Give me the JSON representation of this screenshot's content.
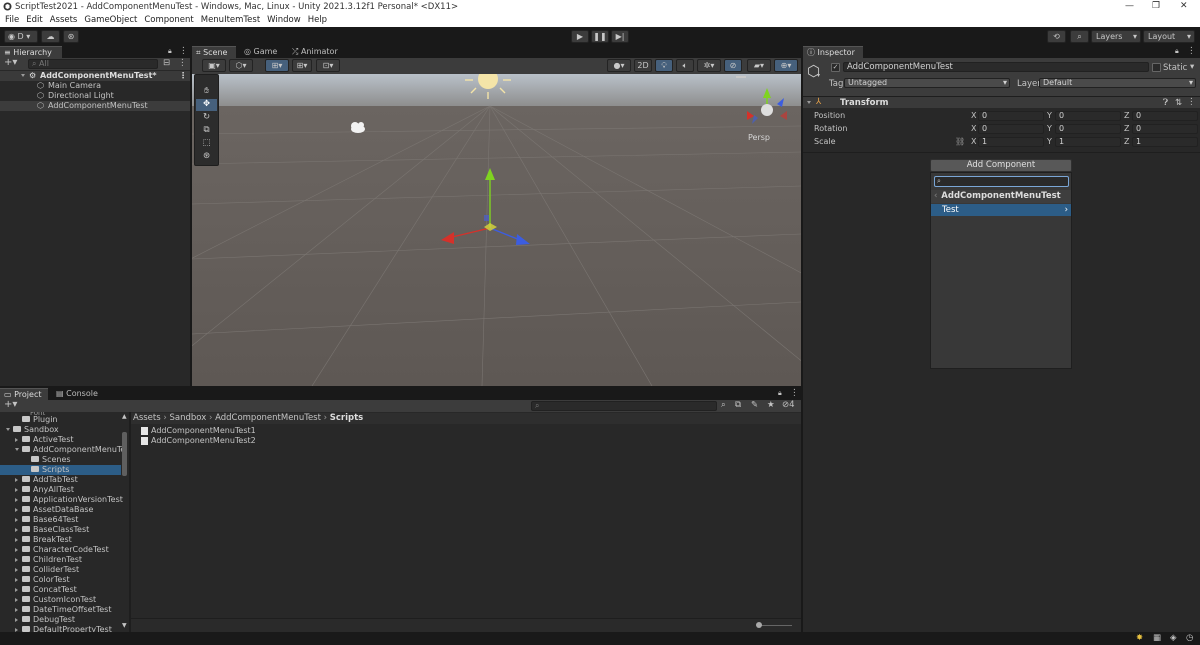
{
  "window": {
    "title": "ScriptTest2021 - AddComponentMenuTest - Windows, Mac, Linux - Unity 2021.3.12f1 Personal* <DX11>",
    "controls": [
      "—",
      "❐",
      "✕"
    ]
  },
  "menu": [
    "File",
    "Edit",
    "Assets",
    "GameObject",
    "Component",
    "MenuItemTest",
    "Window",
    "Help"
  ],
  "toolbar": {
    "account": "D",
    "layers": "Layers",
    "layout": "Layout"
  },
  "hierarchy": {
    "tab": "Hierarchy",
    "search_placeholder": "All",
    "scene": "AddComponentMenuTest*",
    "items": [
      "Main Camera",
      "Directional Light",
      "AddComponentMenuTest"
    ]
  },
  "scene_view": {
    "tabs": [
      "Scene",
      "Game",
      "Animator"
    ],
    "mode_2d": "2D",
    "persp_label": "Persp"
  },
  "inspector": {
    "tab": "Inspector",
    "object_name": "AddComponentMenuTest",
    "static_label": "Static",
    "tag_label": "Tag",
    "tag_value": "Untagged",
    "layer_label": "Layer",
    "layer_value": "Default",
    "component": "Transform",
    "rows": [
      {
        "label": "Position",
        "x": "0",
        "y": "0",
        "z": "0"
      },
      {
        "label": "Rotation",
        "x": "0",
        "y": "0",
        "z": "0"
      },
      {
        "label": "Scale",
        "x": "1",
        "y": "1",
        "z": "1"
      }
    ],
    "axis": {
      "x": "X",
      "y": "Y",
      "z": "Z"
    },
    "add_component": "Add Component",
    "popup_header": "AddComponentMenuTest",
    "popup_item": "Test"
  },
  "project": {
    "tabs": [
      "Project",
      "Console"
    ],
    "tree": [
      {
        "label": "Plugin",
        "indent": 1,
        "arrow": "none"
      },
      {
        "label": "Sandbox",
        "indent": 0,
        "arrow": "down"
      },
      {
        "label": "ActiveTest",
        "indent": 1,
        "arrow": "right"
      },
      {
        "label": "AddComponentMenuTe",
        "indent": 1,
        "arrow": "down"
      },
      {
        "label": "Scenes",
        "indent": 2,
        "arrow": "none"
      },
      {
        "label": "Scripts",
        "indent": 2,
        "arrow": "none",
        "selected": true
      },
      {
        "label": "AddTabTest",
        "indent": 1,
        "arrow": "right"
      },
      {
        "label": "AnyAllTest",
        "indent": 1,
        "arrow": "right"
      },
      {
        "label": "ApplicationVersionTest",
        "indent": 1,
        "arrow": "right"
      },
      {
        "label": "AssetDataBase",
        "indent": 1,
        "arrow": "right"
      },
      {
        "label": "Base64Test",
        "indent": 1,
        "arrow": "right"
      },
      {
        "label": "BaseClassTest",
        "indent": 1,
        "arrow": "right"
      },
      {
        "label": "BreakTest",
        "indent": 1,
        "arrow": "right"
      },
      {
        "label": "CharacterCodeTest",
        "indent": 1,
        "arrow": "right"
      },
      {
        "label": "ChildrenTest",
        "indent": 1,
        "arrow": "right"
      },
      {
        "label": "ColliderTest",
        "indent": 1,
        "arrow": "right"
      },
      {
        "label": "ColorTest",
        "indent": 1,
        "arrow": "right"
      },
      {
        "label": "ConcatTest",
        "indent": 1,
        "arrow": "right"
      },
      {
        "label": "CustomIconTest",
        "indent": 1,
        "arrow": "right"
      },
      {
        "label": "DateTimeOffsetTest",
        "indent": 1,
        "arrow": "right"
      },
      {
        "label": "DebugTest",
        "indent": 1,
        "arrow": "right"
      },
      {
        "label": "DefaultPropertyTest",
        "indent": 1,
        "arrow": "right"
      }
    ],
    "breadcrumb": [
      "Assets",
      "Sandbox",
      "AddComponentMenuTest",
      "Scripts"
    ],
    "files": [
      "AddComponentMenuTest1",
      "AddComponentMenuTest2"
    ],
    "hidden_count": "4"
  }
}
